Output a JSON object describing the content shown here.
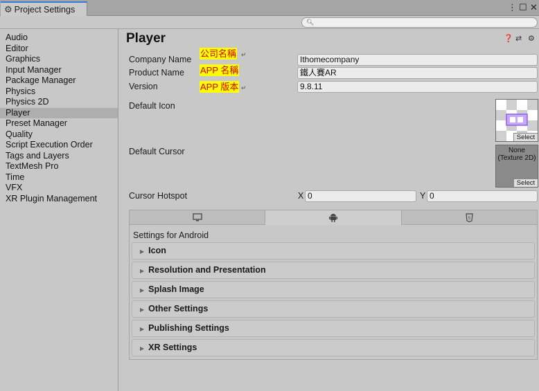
{
  "window": {
    "tab_title": "Project Settings",
    "controls": [
      "⋮",
      "☐",
      "✕"
    ]
  },
  "search": {
    "placeholder": ""
  },
  "sidebar": {
    "items": [
      {
        "label": "Audio"
      },
      {
        "label": "Editor"
      },
      {
        "label": "Graphics"
      },
      {
        "label": "Input Manager"
      },
      {
        "label": "Package Manager"
      },
      {
        "label": "Physics"
      },
      {
        "label": "Physics 2D"
      },
      {
        "label": "Player",
        "selected": true
      },
      {
        "label": "Preset Manager"
      },
      {
        "label": "Quality"
      },
      {
        "label": "Script Execution Order"
      },
      {
        "label": "Tags and Layers"
      },
      {
        "label": "TextMesh Pro"
      },
      {
        "label": "Time"
      },
      {
        "label": "VFX"
      },
      {
        "label": "XR Plugin Management"
      }
    ]
  },
  "main": {
    "title": "Player",
    "header_icons": [
      "help-icon",
      "preset-icon",
      "gear-icon"
    ],
    "company": {
      "label": "Company Name",
      "annotation": "公司名稱",
      "value": "Ithomecompany"
    },
    "product": {
      "label": "Product Name",
      "annotation": "APP 名稱",
      "value": "鐵人賽AR"
    },
    "version": {
      "label": "Version",
      "annotation": "APP 版本",
      "value": "9.8.11"
    },
    "default_icon": {
      "label": "Default Icon",
      "select": "Select"
    },
    "default_cursor": {
      "label": "Default Cursor",
      "value_line1": "None",
      "value_line2": "(Texture 2D)",
      "select": "Select"
    },
    "cursor_hotspot": {
      "label": "Cursor Hotspot",
      "x_label": "X",
      "x_value": "0",
      "y_label": "Y",
      "y_value": "0"
    },
    "platform_tabs": [
      {
        "icon": "monitor-icon",
        "active": false
      },
      {
        "icon": "android-icon",
        "active": true
      },
      {
        "icon": "html5-icon",
        "active": false
      }
    ],
    "settings_for": "Settings for Android",
    "sections": [
      {
        "label": "Icon"
      },
      {
        "label": "Resolution and Presentation"
      },
      {
        "label": "Splash Image"
      },
      {
        "label": "Other Settings"
      },
      {
        "label": "Publishing Settings"
      },
      {
        "label": "XR Settings"
      }
    ]
  },
  "colors": {
    "accent_tab": "#3a7ad8",
    "annotation_bg": "#ffff00",
    "annotation_text": "#d10000"
  }
}
